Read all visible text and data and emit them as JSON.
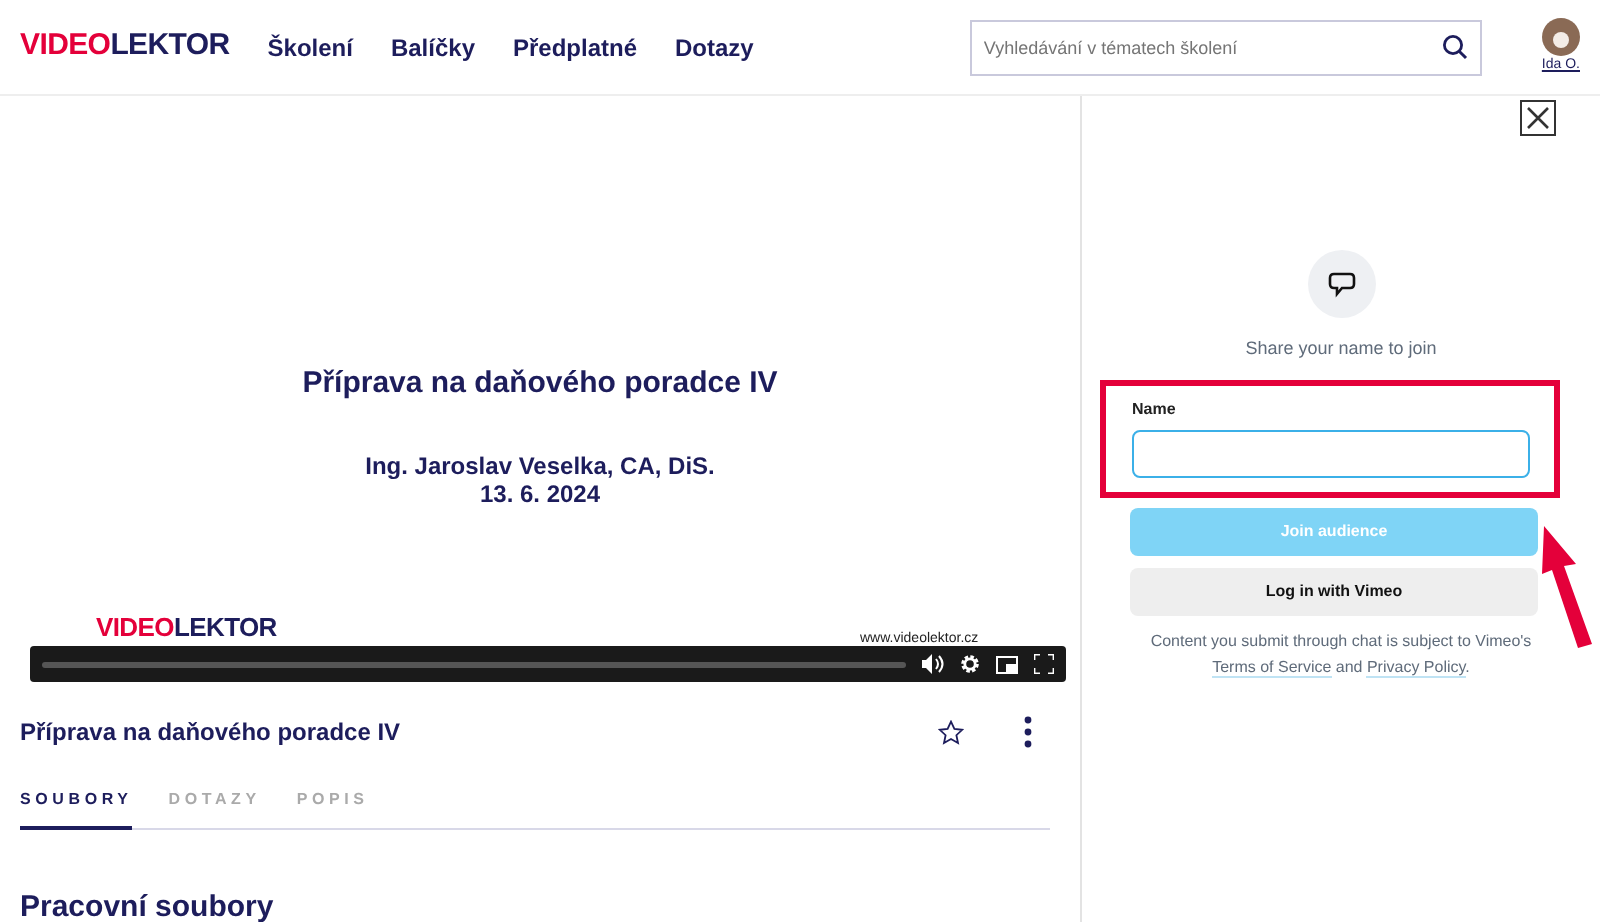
{
  "header": {
    "logo": {
      "part_1": "VIDEO",
      "part_2": "LEKTOR"
    },
    "nav": [
      {
        "label": "Školení"
      },
      {
        "label": "Balíčky"
      },
      {
        "label": "Předplatné"
      },
      {
        "label": "Dotazy"
      }
    ],
    "search": {
      "placeholder": "Vyhledávání v tématech školení"
    },
    "user": {
      "name": "Ida O."
    }
  },
  "video": {
    "slide": {
      "title": "Příprava na daňového poradce IV",
      "author": "Ing. Jaroslav Veselka, CA, DiS.",
      "date": "13. 6. 2024",
      "logo": {
        "part_1": "VIDEO",
        "part_2": "LEKTOR"
      },
      "url": "www.videolektor.cz"
    }
  },
  "lesson": {
    "title": "Příprava na daňového poradce IV",
    "favorite": false,
    "tabs": [
      {
        "label": "SOUBORY",
        "selected": true
      },
      {
        "label": "DOTAZY",
        "selected": false
      },
      {
        "label": "POPIS",
        "selected": false
      }
    ],
    "section_heading": "Pracovní soubory"
  },
  "chat_panel": {
    "prompt": "Share your name to join",
    "field": {
      "label": "Name"
    },
    "buttons": [
      {
        "label": "Join audience",
        "kind": "primary",
        "disabled": true
      },
      {
        "label": "Log in with Vimeo",
        "kind": "secondary"
      }
    ],
    "footer": {
      "text_1": "Content you submit through chat is subject to Vimeo's",
      "link_1": "Terms of Service",
      "text_2": "and",
      "link_2": "Privacy Policy",
      "text_3": "."
    }
  }
}
